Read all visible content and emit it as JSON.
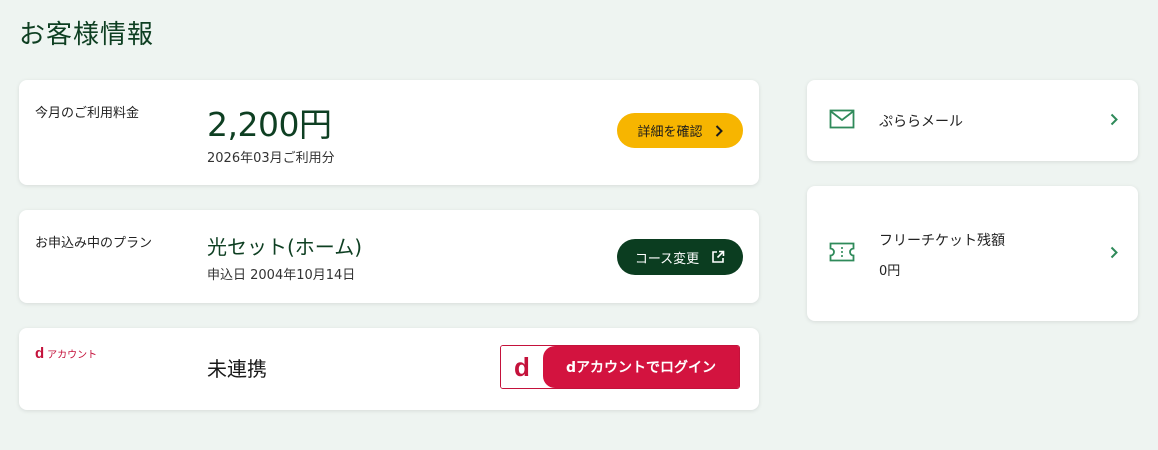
{
  "page_title": "お客様情報",
  "fee": {
    "label": "今月のご利用料金",
    "amount": "2,200円",
    "period": "2026年03月ご利用分",
    "detail_button": "詳細を確認"
  },
  "plan": {
    "label": "お申込み中のプラン",
    "name": "光セット(ホーム)",
    "applied_date": "申込日 2004年10月14日",
    "change_button": "コース変更"
  },
  "d_account": {
    "logo_d": "d",
    "logo_text": "アカウント",
    "status": "未連携",
    "login_button_d": "d",
    "login_button": "dアカウントでログイン"
  },
  "side": {
    "mail_label": "ぷららメール",
    "ticket_label": "フリーチケット残額",
    "ticket_balance": "0円"
  },
  "colors": {
    "accent_green": "#0b3d20",
    "button_yellow": "#f7b500",
    "docomo_red": "#d3133f",
    "icon_green": "#2f8a5a"
  }
}
